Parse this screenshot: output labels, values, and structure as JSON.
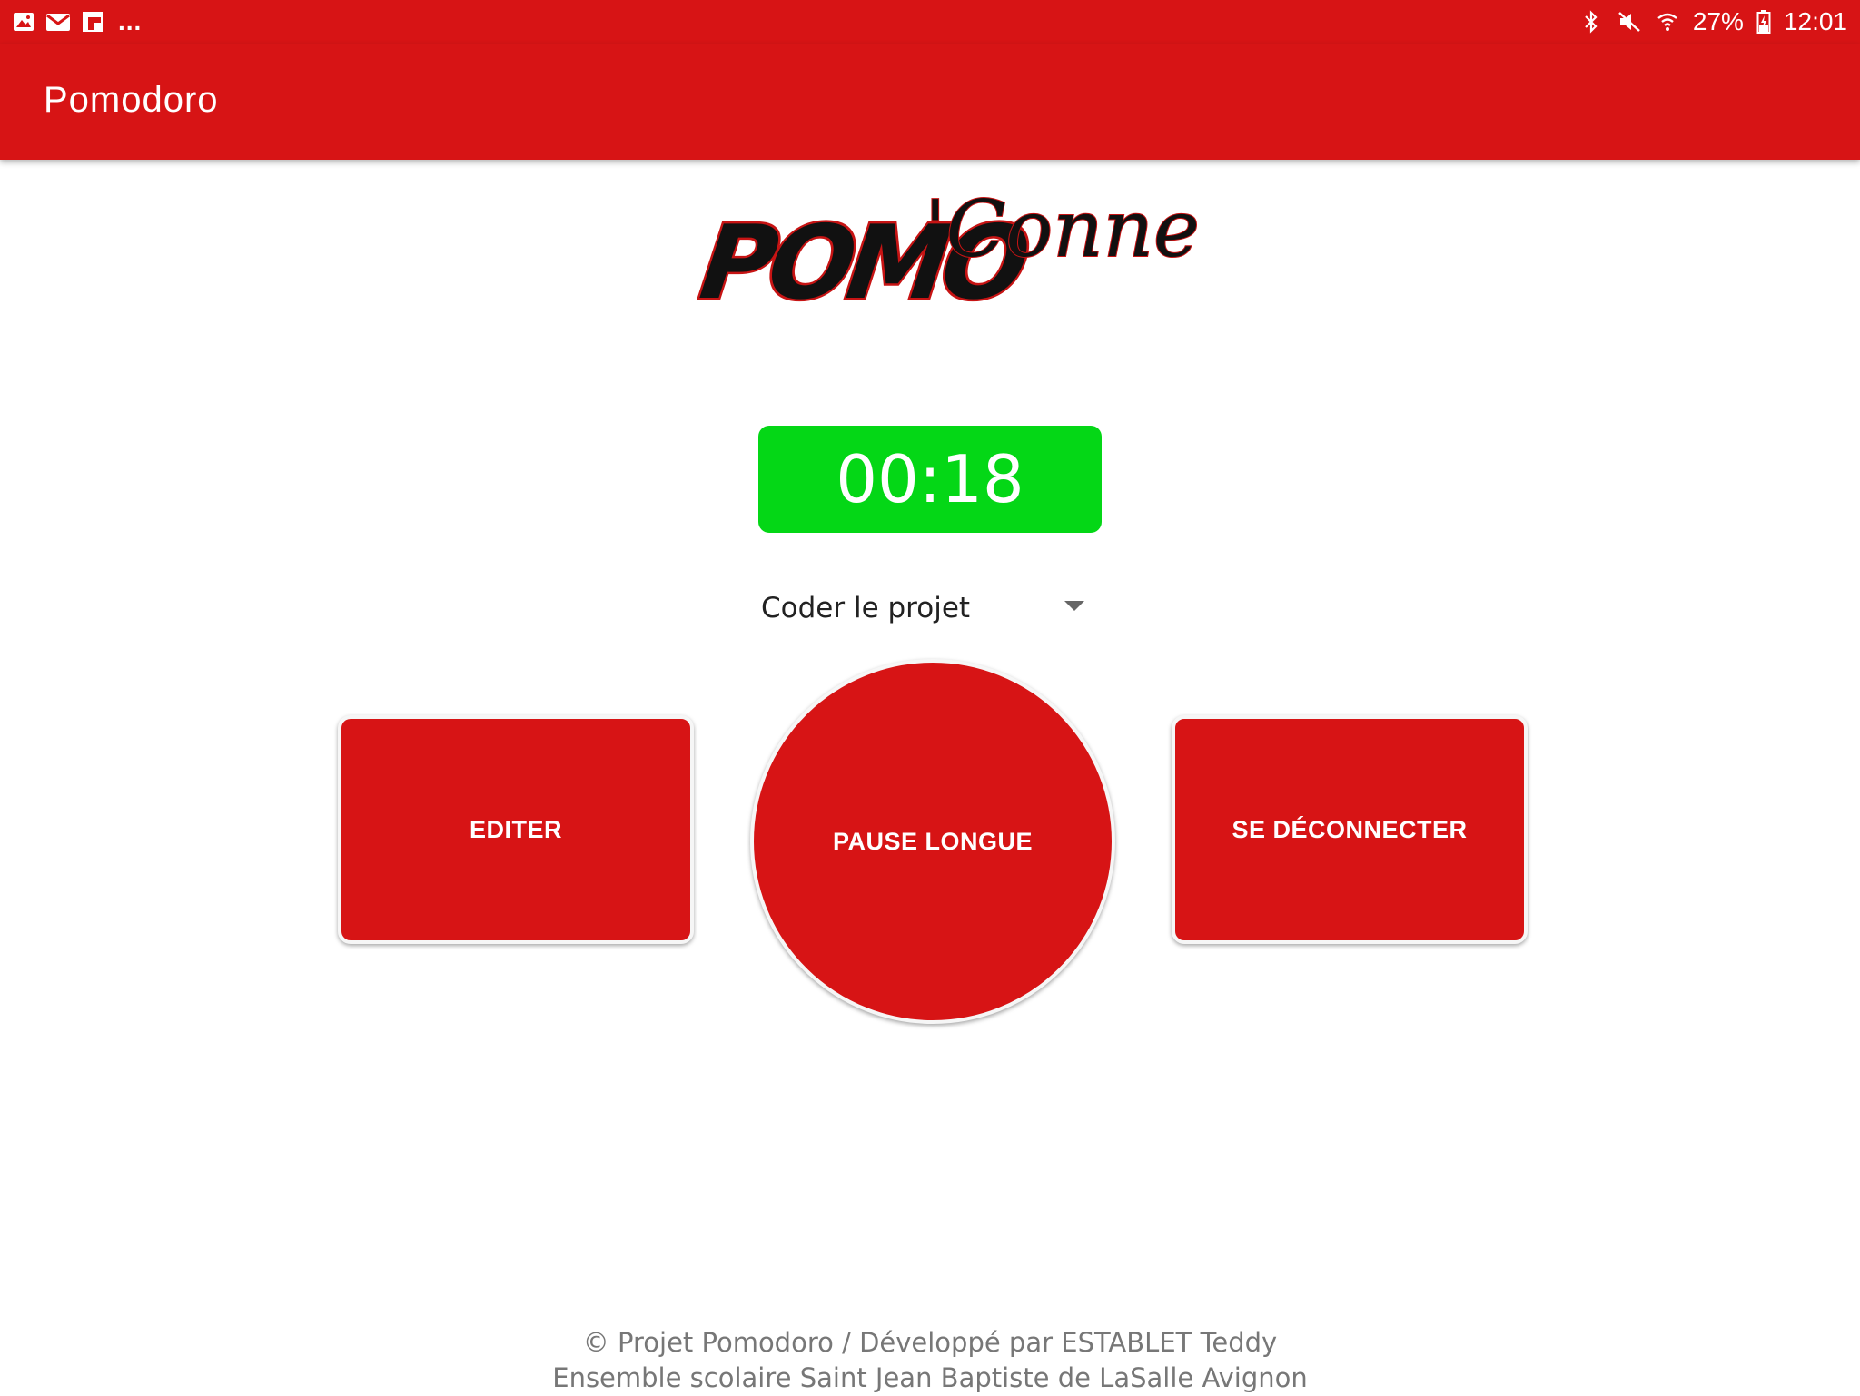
{
  "status_bar": {
    "left_icons": [
      "gallery-icon",
      "gmail-icon",
      "flipboard-icon"
    ],
    "more": "...",
    "right_icons": [
      "bluetooth-icon",
      "mute-icon",
      "wifi-icon"
    ],
    "battery_percent": "27%",
    "battery_icon": "battery-charging-icon",
    "time": "12:01"
  },
  "app_bar": {
    "title": "Pomodoro"
  },
  "logo": {
    "word1": "POMO",
    "word2": "'Connect"
  },
  "timer": {
    "value": "00:18",
    "color": "#04d716"
  },
  "task_select": {
    "selected": "Coder le projet"
  },
  "buttons": {
    "edit": "EDITER",
    "pause": "PAUSE LONGUE",
    "logout": "SE DÉCONNECTER"
  },
  "footer": {
    "line1": "© Projet Pomodoro / Développé par ESTABLET Teddy",
    "line2": "Ensemble scolaire Saint Jean Baptiste de LaSalle Avignon"
  },
  "colors": {
    "primary": "#d71415",
    "timer": "#04d716",
    "text_muted": "#777777"
  }
}
